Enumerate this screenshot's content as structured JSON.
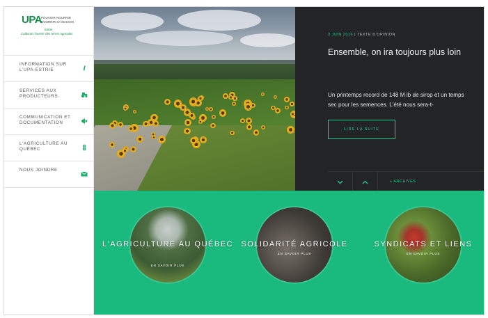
{
  "sidebar": {
    "logo": {
      "mark": "UPA",
      "lines": [
        "POUVOIR NOURRIR",
        "NOURRIR SA MAISON",
        "—"
      ],
      "region": "Estrie",
      "tagline": "Cultivons l'avenir des terres agricoles"
    },
    "items": [
      {
        "label": "Information sur l'UPA-Estrie",
        "icon": "info-icon"
      },
      {
        "label": "Services aux producteurs",
        "icon": "tractor-icon"
      },
      {
        "label": "Communication et documentation",
        "icon": "megaphone-icon"
      },
      {
        "label": "L'agriculture au Québec",
        "icon": "plant-icon"
      },
      {
        "label": "Nous joindre",
        "icon": "mail-icon"
      }
    ]
  },
  "news": {
    "date": "3 JUIN 2016",
    "category": "TEXTE D'OPINION",
    "title": "Ensemble, on ira toujours plus loin",
    "excerpt": "Un printemps record de 148 M lb de sirop et un temps sec pour les semences. L'été nous sera-t-",
    "read_more": "Lire la suite",
    "prev_label": "⌄",
    "next_label": "⌃",
    "archives": "+ Archives"
  },
  "cards": [
    {
      "title": "L'agriculture au Québec",
      "link": "En savoir plus"
    },
    {
      "title": "Solidarité agricole",
      "link": "En savoir plus"
    },
    {
      "title": "Syndicats et liens",
      "link": "En savoir plus"
    }
  ],
  "colors": {
    "accent": "#1ab97d",
    "accent_text": "#1dd18b",
    "dark_panel": "#222426",
    "logo_green": "#178c46"
  }
}
